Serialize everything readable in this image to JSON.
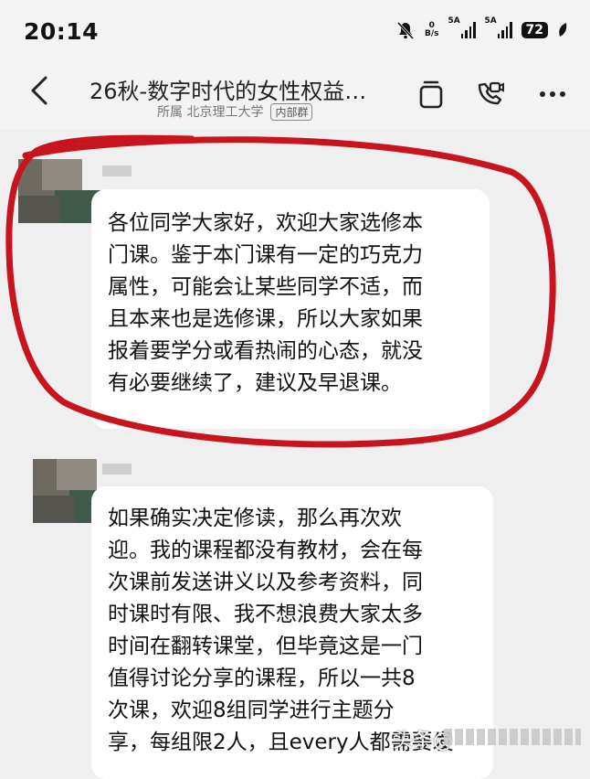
{
  "status_bar": {
    "time": "20:14",
    "net_speed_value": "0",
    "net_speed_unit": "B/s",
    "signal1_label": "5A",
    "signal2_label": "5A",
    "battery": "72"
  },
  "header": {
    "title": "26秋-数字时代的女性权益…",
    "subtitle": "所属 北京理工大学",
    "badge": "内部群"
  },
  "messages": [
    {
      "lines": [
        "各位同学大家好，欢迎大家选修本",
        "门课。鉴于本门课有一定的巧克力",
        "属性，可能会让某些同学不适，而",
        "且本来也是选修课，所以大家如果",
        "报着要学分或看热闹的心态，就没",
        "有必要继续了，建议及早退课。"
      ]
    },
    {
      "lines": [
        "如果确实决定修读，那么再次欢",
        "迎。我的课程都没有教材，会在每",
        "次课前发送讲义以及参考资料，同",
        "时课时有限、我不想浪费大家太多",
        "时间在翻转课堂，但毕竟这是一门",
        "值得讨论分享的课程，所以一共8",
        "次课，欢迎8组同学进行主题分",
        "享，每组限2人，且every人都需要发"
      ]
    }
  ],
  "watermark": "头条@",
  "colors": {
    "annotation_circle": "#c8141c",
    "bubble": "#ffffff",
    "background": "#efefef"
  }
}
